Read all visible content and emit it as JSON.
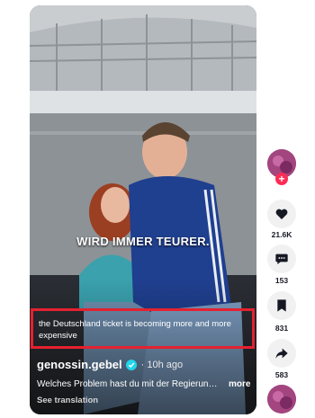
{
  "video": {
    "overlay_caption": "WIRD IMMER TEURER.",
    "subtitle": "the Deutschland ticket is becoming more and more expensive",
    "author": "genossin.gebel",
    "time_ago": "· 10h ago",
    "description": "Welches Problem hast du mit der Regierung?...",
    "more_label": "more",
    "translation_label": "See translation"
  },
  "actions": {
    "likes": "21.6K",
    "comments": "153",
    "saves": "831",
    "shares": "583"
  },
  "icons": {
    "like": "heart-icon",
    "comment": "comment-icon",
    "save": "bookmark-icon",
    "share": "share-icon",
    "verified": "verified-check-icon"
  },
  "colors": {
    "follow": "#fe2c55",
    "verified": "#20d5ec",
    "highlight": "#e5212f"
  }
}
